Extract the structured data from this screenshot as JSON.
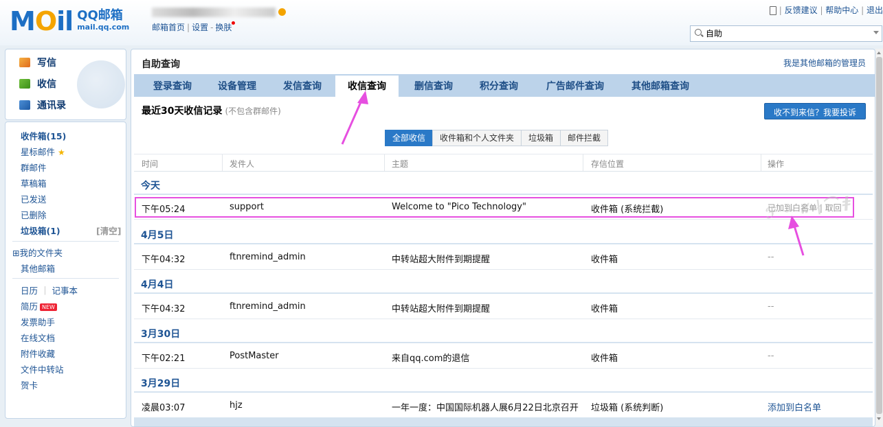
{
  "header": {
    "logo_text": "MOil",
    "logo_brand": "QQ邮箱",
    "logo_domain": "mail.qq.com",
    "account_prefix": "",
    "links": [
      "邮箱首页",
      "设置",
      "换肤"
    ],
    "top_links": [
      "反馈建议",
      "帮助中心",
      "退出"
    ],
    "search_value": "自助"
  },
  "sidebar": {
    "quick_actions": [
      "写信",
      "收信",
      "通讯录"
    ],
    "inbox": "收件箱(15)",
    "starred": "星标邮件",
    "groups": "群邮件",
    "drafts": "草稿箱",
    "sent": "已发送",
    "deleted": "已删除",
    "spam": "垃圾箱(1)",
    "spam_clear": "[清空]",
    "my_folders": "⊞我的文件夹",
    "other_mailboxes": "其他邮箱",
    "calendar": "日历",
    "notes": "记事本",
    "resume": "简历",
    "resume_badge": "NEW",
    "invoice": "发票助手",
    "docs": "在线文档",
    "attachments": "附件收藏",
    "transfer": "文件中转站",
    "cards": "贺卡"
  },
  "main": {
    "title": "自助查询",
    "admin_link": "我是其他邮箱的管理员",
    "tabs": [
      "登录查询",
      "设备管理",
      "发信查询",
      "收信查询",
      "删信查询",
      "积分查询",
      "广告邮件查询",
      "其他邮箱查询"
    ],
    "active_tab": "收信查询",
    "section_title": "最近30天收信记录",
    "section_note": "(不包含群邮件)",
    "complain_button": "收不到来信？我要投诉",
    "filters": [
      "全部收信",
      "收件箱和个人文件夹",
      "垃圾箱",
      "邮件拦截"
    ],
    "columns": [
      "时间",
      "发件人",
      "主题",
      "存信位置",
      "操作"
    ],
    "days": [
      {
        "label": "今天",
        "rows": [
          {
            "time": "下午05:24",
            "sender": "support",
            "subject": "Welcome to \"Pico Technology\"",
            "location": "收件箱 (系统拦截)",
            "op": "已加到白名单 | 取回"
          }
        ]
      },
      {
        "label": "4月5日",
        "rows": [
          {
            "time": "下午04:32",
            "sender": "ftnremind_admin",
            "subject": "中转站超大附件到期提醒",
            "location": "收件箱",
            "op": "--"
          }
        ]
      },
      {
        "label": "4月4日",
        "rows": [
          {
            "time": "下午04:32",
            "sender": "ftnremind_admin",
            "subject": "中转站超大附件到期提醒",
            "location": "收件箱",
            "op": "--"
          }
        ]
      },
      {
        "label": "3月30日",
        "rows": [
          {
            "time": "下午02:21",
            "sender": "PostMaster",
            "subject": "来自qq.com的退信",
            "location": "收件箱",
            "op": "--"
          }
        ]
      },
      {
        "label": "3月29日",
        "rows": [
          {
            "time": "凌晨03:07",
            "sender": "hjz",
            "subject": "一年一度：中国国际机器人展6月22日北京召开",
            "location": "垃圾箱 (系统判断)",
            "op": "添加到白名单"
          }
        ]
      }
    ]
  },
  "colors": {
    "accent": "#2a79c7",
    "tab_bar": "#bcd3ea",
    "highlight": "#e64fe0"
  }
}
